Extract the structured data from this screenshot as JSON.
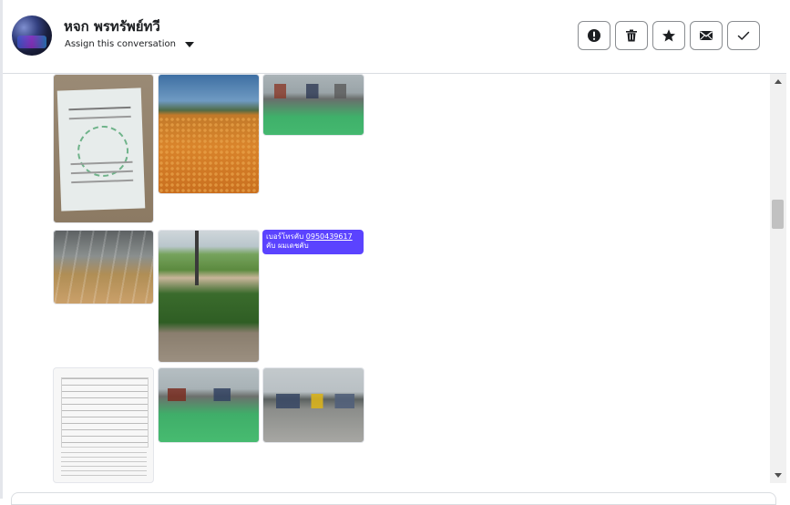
{
  "header": {
    "contact_name": "หจก พรทรัพย์ทวี",
    "assign_label": "Assign this conversation"
  },
  "actions": [
    {
      "name": "alert-icon",
      "label": "Mark as spam"
    },
    {
      "name": "trash-icon",
      "label": "Delete"
    },
    {
      "name": "star-icon",
      "label": "Star"
    },
    {
      "name": "envelope-icon",
      "label": "Mark as unread"
    },
    {
      "name": "check-icon",
      "label": "Mark as done"
    }
  ],
  "message": {
    "text_before": "เบอร์โทรคับ ",
    "phone": "0950439617",
    "text_after": " คับ ผมเดชคับ"
  },
  "colors": {
    "bubble": "#5b43ff",
    "border": "#dadde1"
  }
}
